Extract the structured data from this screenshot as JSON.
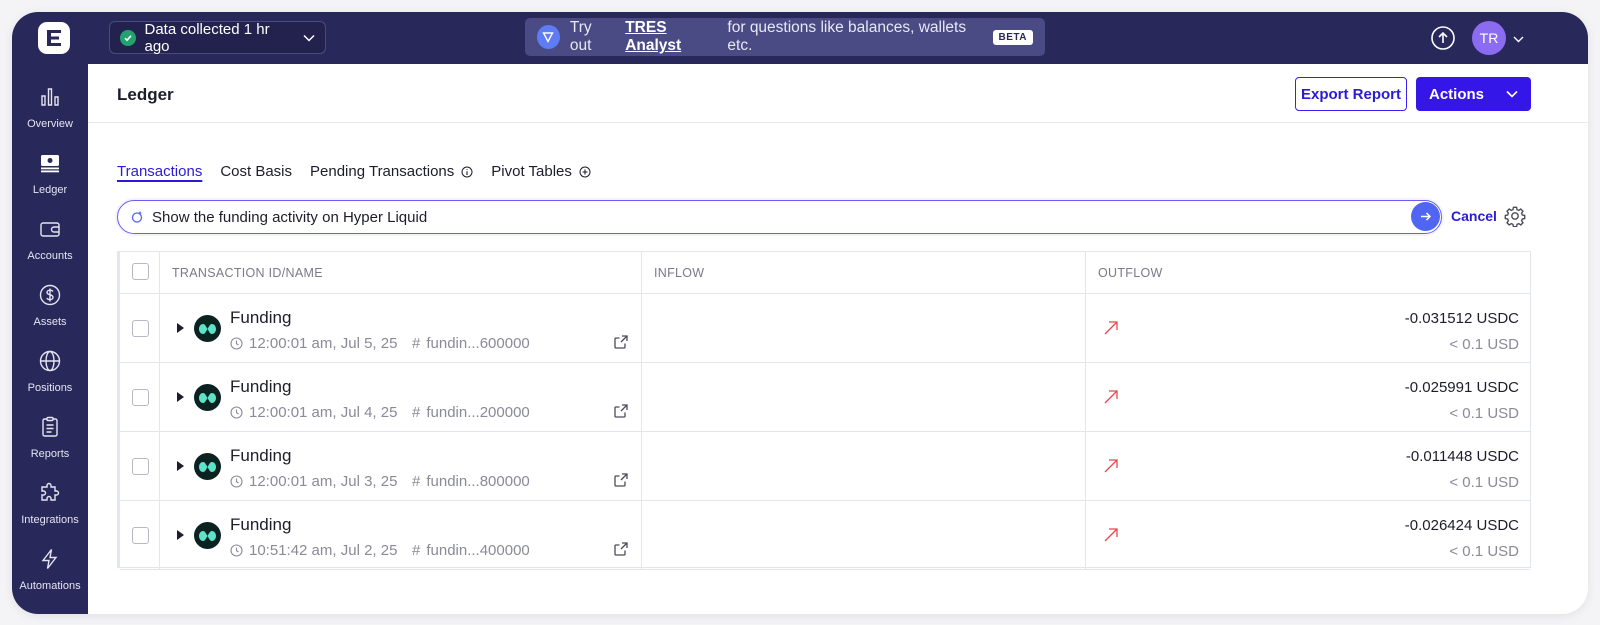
{
  "topbar": {
    "status_text": "Data collected 1 hr ago",
    "promo": {
      "prefix": "Try out",
      "link": "TRES Analyst",
      "suffix": "for questions like balances, wallets etc.",
      "badge": "BETA"
    },
    "avatar_initials": "TR"
  },
  "sidebar": {
    "items": [
      {
        "label": "Overview",
        "icon": "bar-chart-icon"
      },
      {
        "label": "Ledger",
        "icon": "ledger-icon"
      },
      {
        "label": "Accounts",
        "icon": "wallet-icon"
      },
      {
        "label": "Assets",
        "icon": "dollar-icon"
      },
      {
        "label": "Positions",
        "icon": "globe-icon"
      },
      {
        "label": "Reports",
        "icon": "clipboard-icon"
      },
      {
        "label": "Integrations",
        "icon": "puzzle-icon"
      },
      {
        "label": "Automations",
        "icon": "lightning-icon"
      }
    ],
    "active": "Ledger"
  },
  "header": {
    "title": "Ledger",
    "export_label": "Export Report",
    "actions_label": "Actions"
  },
  "tabs": [
    {
      "label": "Transactions",
      "active": true
    },
    {
      "label": "Cost Basis"
    },
    {
      "label": "Pending Transactions",
      "icon": "info-icon"
    },
    {
      "label": "Pivot Tables",
      "icon": "plus-circle-icon"
    }
  ],
  "search": {
    "query": "Show the funding activity on Hyper Liquid",
    "cancel_label": "Cancel"
  },
  "table": {
    "columns": [
      "TRANSACTION ID/NAME",
      "INFLOW",
      "OUTFLOW"
    ],
    "rows": [
      {
        "name": "Funding",
        "time": "12:00:01 am, Jul 5, 25",
        "hash": "fundin...600000",
        "amount": "-0.031512 USDC",
        "usd": "< 0.1 USD"
      },
      {
        "name": "Funding",
        "time": "12:00:01 am, Jul 4, 25",
        "hash": "fundin...200000",
        "amount": "-0.025991 USDC",
        "usd": "< 0.1 USD"
      },
      {
        "name": "Funding",
        "time": "12:00:01 am, Jul 3, 25",
        "hash": "fundin...800000",
        "amount": "-0.011448 USDC",
        "usd": "< 0.1 USD"
      },
      {
        "name": "Funding",
        "time": "10:51:42 am, Jul 2, 25",
        "hash": "fundin...400000",
        "amount": "-0.026424 USDC",
        "usd": "< 0.1 USD"
      }
    ]
  },
  "colors": {
    "nav_bg": "#29285a",
    "accent": "#3417e8",
    "status_green": "#23a26d",
    "outflow_red": "#e5484d",
    "token_teal": "#5fe3c8"
  }
}
